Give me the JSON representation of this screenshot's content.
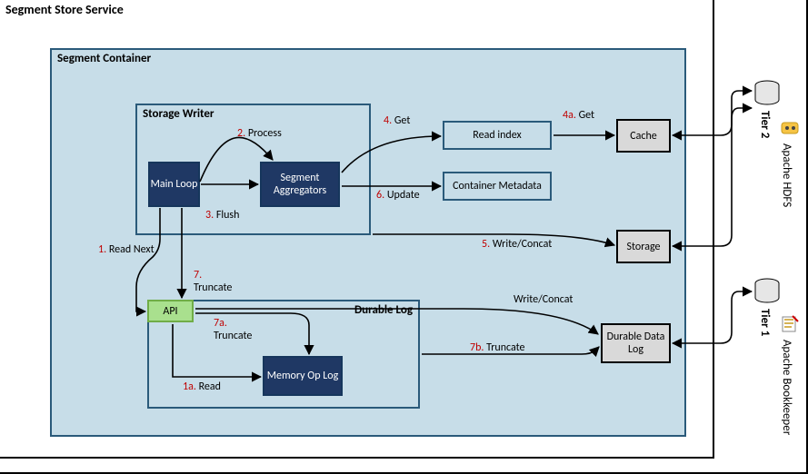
{
  "outer": {
    "title": "Segment Store Service"
  },
  "container": {
    "title": "Segment Container"
  },
  "storageWriter": {
    "title": "Storage Writer"
  },
  "durableLog": {
    "title": "Durable Log"
  },
  "boxes": {
    "mainLoop": "Main Loop",
    "segAgg": "Segment Aggregators",
    "api": "API",
    "memOpLog": "Memory Op Log",
    "readIndex": "Read index",
    "containerMeta": "Container Metadata",
    "cache": "Cache",
    "storage": "Storage",
    "durableDataLog": "Durable Data Log"
  },
  "tiers": {
    "tier1": "Tier 1",
    "tier2": "Tier 2",
    "bookkeeper": "Apache Bookkeeper",
    "hdfs": "Apache HDFS"
  },
  "steps": {
    "s1": {
      "n": "1.",
      "t": "Read Next"
    },
    "s1a": {
      "n": "1a.",
      "t": "Read"
    },
    "s2": {
      "n": "2.",
      "t": "Process"
    },
    "s3": {
      "n": "3.",
      "t": "Flush"
    },
    "s4": {
      "n": "4.",
      "t": "Get"
    },
    "s4a": {
      "n": "4a.",
      "t": "Get"
    },
    "s5": {
      "n": "5.",
      "t": "Write/Concat"
    },
    "s6": {
      "n": "6.",
      "t": "Update"
    },
    "s7": {
      "n": "7.",
      "t": "Truncate"
    },
    "s7a": {
      "n": "7a.",
      "t": "Truncate"
    },
    "s7b": {
      "n": "7b.",
      "t": "Truncate"
    },
    "wc": "Write/Concat"
  }
}
